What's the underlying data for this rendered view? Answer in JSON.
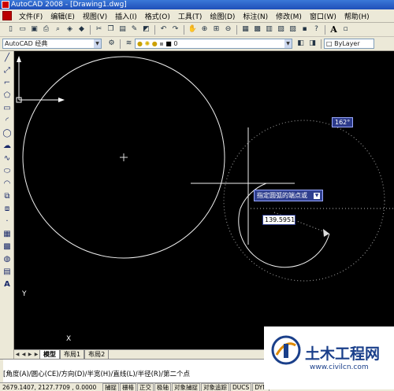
{
  "window": {
    "title": "AutoCAD 2008 - [Drawing1.dwg]"
  },
  "menubar": {
    "items": [
      "文件(F)",
      "编辑(E)",
      "视图(V)",
      "插入(I)",
      "格式(O)",
      "工具(T)",
      "绘图(D)",
      "标注(N)",
      "修改(M)",
      "窗口(W)",
      "帮助(H)"
    ]
  },
  "toolbar2": {
    "workspace": "AutoCAD 经典",
    "layer": "0",
    "linetype": "ByLayer"
  },
  "canvas": {
    "angle_tooltip": "162°",
    "prompt_tooltip": "指定圆弧的端点或",
    "value_input": "139.5951"
  },
  "ucs": {
    "x_label": "X",
    "y_label": "Y"
  },
  "tabs": [
    "模型",
    "布局1",
    "布局2"
  ],
  "command": {
    "text": "[角度(A)/圆心(CE)/方向(D)/半宽(H)/直线(L)/半径(R)/第二个点"
  },
  "status": {
    "coords": "2679.1407, 2127.7709 , 0.0000",
    "buttons": [
      "捕捉",
      "栅格",
      "正交",
      "极轴",
      "对象捕捉",
      "对象追踪",
      "DUCS",
      "DYN"
    ]
  },
  "watermark": {
    "title": "土木工程网",
    "url": "www.civilcn.com"
  },
  "colors": {
    "canvas_bg": "#000000",
    "tooltip_bg": "#2f3f8f",
    "title_bg": "#1f4fb8"
  }
}
